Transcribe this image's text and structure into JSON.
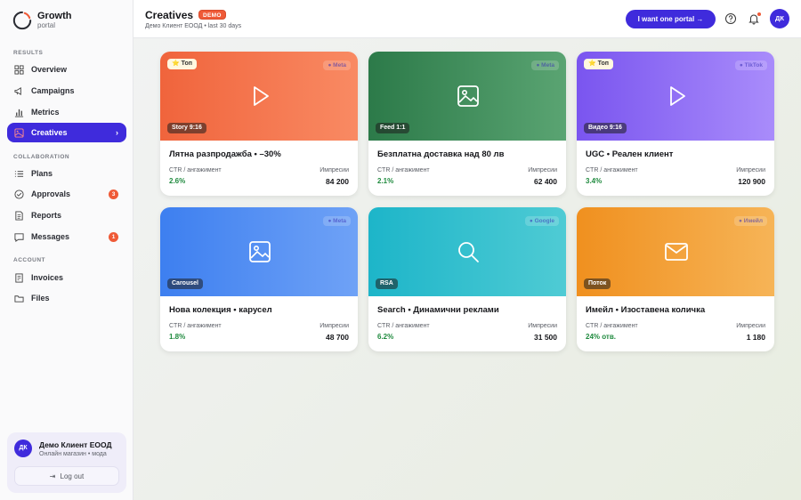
{
  "brand": {
    "title": "Growth",
    "subtitle": "portal"
  },
  "sidebar": {
    "sections": [
      "RESULTS",
      "COLLABORATION",
      "ACCOUNT"
    ],
    "items": [
      {
        "label": "Overview",
        "icon": "grid-icon"
      },
      {
        "label": "Campaigns",
        "icon": "megaphone-icon"
      },
      {
        "label": "Metrics",
        "icon": "bar-chart-icon"
      },
      {
        "label": "Creatives",
        "icon": "image-icon",
        "active": true,
        "chevron": "›"
      },
      {
        "label": "Plans",
        "icon": "list-icon"
      },
      {
        "label": "Approvals",
        "icon": "check-circle-icon",
        "badge": "3"
      },
      {
        "label": "Reports",
        "icon": "document-icon"
      },
      {
        "label": "Messages",
        "icon": "chat-icon",
        "badge": "1"
      },
      {
        "label": "Invoices",
        "icon": "invoice-icon"
      },
      {
        "label": "Files",
        "icon": "folder-icon"
      }
    ]
  },
  "user": {
    "initials": "ДК",
    "name": "Демо Клиент ЕООД",
    "subtitle": "Онлайн магазин • мода",
    "logout_label": "Log out"
  },
  "header": {
    "title": "Creatives",
    "badge": "DEMO",
    "subtitle": "Демо Клиент ЕООД • last 30 days",
    "cta_label": "I want one  portal →",
    "avatar_initials": "ДК"
  },
  "colors": {
    "accent": "#3f2bdc",
    "alert": "#ef5a37",
    "positive": "#1f8a3e"
  },
  "cards": [
    {
      "title": "Лятна разпродажба • –30%",
      "format": "Story 9:16",
      "top": "⭐ Топ",
      "platform": "● Meta",
      "media": "play-icon",
      "gradient": [
        "#f0643c",
        "#f98a63"
      ],
      "metric_label": "CTR / ангажимент",
      "metric_value": "2.6%",
      "imp_label": "Импресии",
      "imp_value": "84 200"
    },
    {
      "title": "Безплатна доставка над 80 лв",
      "format": "Feed 1:1",
      "top": "",
      "platform": "● Meta",
      "media": "image-icon",
      "gradient": [
        "#2c7a49",
        "#5aa472"
      ],
      "metric_label": "CTR / ангажимент",
      "metric_value": "2.1%",
      "imp_label": "Импресии",
      "imp_value": "62 400"
    },
    {
      "title": "UGC • Реален клиент",
      "format": "Видео 9:16",
      "top": "⭐ Топ",
      "platform": "● TikTok",
      "media": "play-icon",
      "gradient": [
        "#7a55ef",
        "#a98cfb"
      ],
      "metric_label": "CTR / ангажимент",
      "metric_value": "3.4%",
      "imp_label": "Импресии",
      "imp_value": "120 900"
    },
    {
      "title": "Нова колекция • карусел",
      "format": "Carousel",
      "top": "",
      "platform": "● Meta",
      "media": "image-icon",
      "gradient": [
        "#3d7ff0",
        "#6fa2f6"
      ],
      "metric_label": "CTR / ангажимент",
      "metric_value": "1.8%",
      "imp_label": "Импресии",
      "imp_value": "48 700"
    },
    {
      "title": "Search • Динамични реклами",
      "format": "RSA",
      "top": "",
      "platform": "● Google",
      "media": "search-icon",
      "gradient": [
        "#1db5c9",
        "#4fcbd4"
      ],
      "metric_label": "CTR / ангажимент",
      "metric_value": "6.2%",
      "imp_label": "Импресии",
      "imp_value": "31 500"
    },
    {
      "title": "Имейл • Изоставена количка",
      "format": "Поток",
      "top": "",
      "platform": "● Имейл",
      "media": "mail-icon",
      "gradient": [
        "#f0901f",
        "#f6b457"
      ],
      "metric_label": "CTR / ангажимент",
      "metric_value": "24% отв.",
      "imp_label": "Импресии",
      "imp_value": "1 180"
    }
  ]
}
